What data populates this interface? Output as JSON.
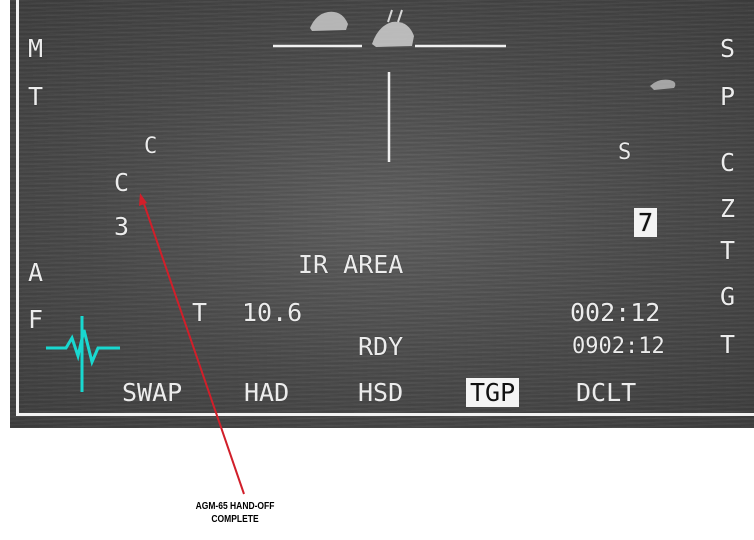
{
  "mfd": {
    "left_column": [
      "M",
      "T",
      "A",
      "F"
    ],
    "right_column": [
      "S",
      "P",
      "C",
      "Z",
      "T",
      "G",
      "T"
    ],
    "c_small": "C",
    "c_large": "C",
    "c_number": "3",
    "s_label": "S",
    "boxed_number": "7",
    "mode_text": "IR AREA",
    "t_label": "T",
    "t_value": "10.6",
    "rdy_text": "RDY",
    "time_top": "002:12",
    "time_bottom": "0902:12",
    "osb_bottom": [
      {
        "label": "SWAP",
        "active": false
      },
      {
        "label": "HAD",
        "active": false
      },
      {
        "label": "HSD",
        "active": false
      },
      {
        "label": "TGP",
        "active": true
      },
      {
        "label": "DCLT",
        "active": false
      }
    ]
  },
  "annotation": {
    "line1": "AGM-65 HAND-OFF",
    "line2": "COMPLETE",
    "color": "#d11f2a"
  },
  "colors": {
    "symbology": "#ececec",
    "horizon_symbol": "#19d8d0"
  }
}
